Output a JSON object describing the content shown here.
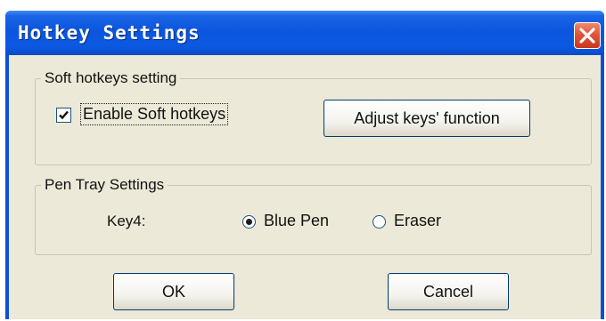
{
  "window": {
    "title": "Hotkey Settings"
  },
  "soft_group": {
    "legend": "Soft hotkeys setting",
    "enable_checkbox": {
      "label": "Enable Soft hotkeys",
      "checked": true
    },
    "adjust_button_label": "Adjust keys' function"
  },
  "pen_group": {
    "legend": "Pen Tray Settings",
    "key_label": "Key4:",
    "options": [
      {
        "label": "Blue Pen",
        "selected": true
      },
      {
        "label": "Eraser",
        "selected": false
      }
    ]
  },
  "buttons": {
    "ok_label": "OK",
    "cancel_label": "Cancel"
  },
  "icons": {
    "close": "close-icon",
    "check": "checkmark-icon"
  },
  "colors": {
    "titlebar": "#0a56de",
    "close_button": "#e2553a",
    "dialog_background": "#ece9d8"
  }
}
